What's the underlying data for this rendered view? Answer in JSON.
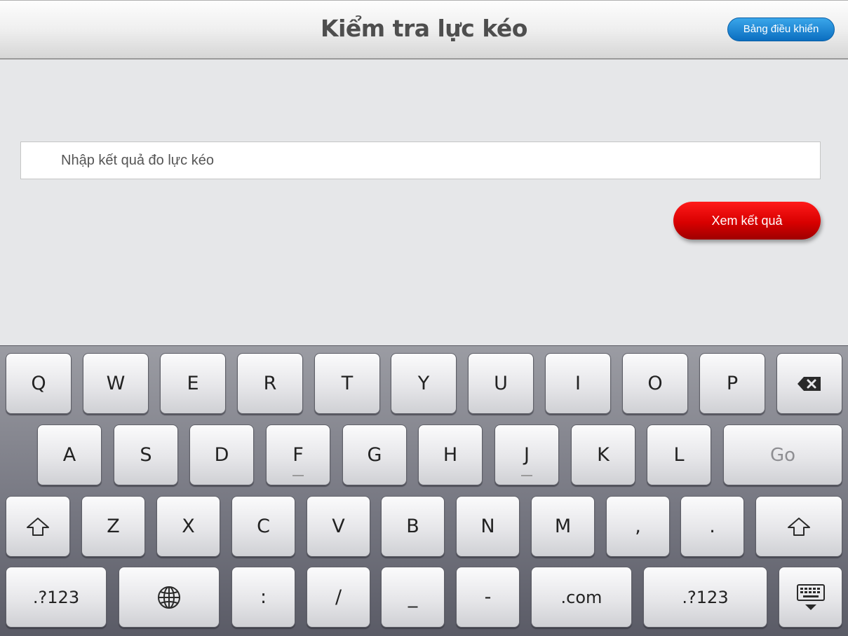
{
  "header": {
    "title": "Kiểm tra lực kéo",
    "dashboard_label": "Bảng điều khiển"
  },
  "form": {
    "input_placeholder": "Nhập kết quả đo lực kéo",
    "input_value": "",
    "submit_label": "Xem kết quả"
  },
  "keyboard": {
    "row1": [
      "Q",
      "W",
      "E",
      "R",
      "T",
      "Y",
      "U",
      "I",
      "O",
      "P"
    ],
    "row2": [
      "A",
      "S",
      "D",
      "F",
      "G",
      "H",
      "J",
      "K",
      "L"
    ],
    "go_label": "Go",
    "row3": [
      "Z",
      "X",
      "C",
      "V",
      "B",
      "N",
      "M",
      ",",
      "."
    ],
    "row4": {
      "numbers_left": ".?123",
      "colon": ":",
      "slash": "/",
      "underscore": "_",
      "dash": "-",
      "dotcom": ".com",
      "numbers_right": ".?123"
    },
    "icons": {
      "backspace": "backspace-icon",
      "shift": "shift-icon",
      "globe": "globe-icon",
      "dismiss": "keyboard-dismiss-icon"
    }
  },
  "colors": {
    "dashboard_button": "#1a86d6",
    "submit_button": "#e00000",
    "keyboard_bg": "#7a7b85"
  }
}
